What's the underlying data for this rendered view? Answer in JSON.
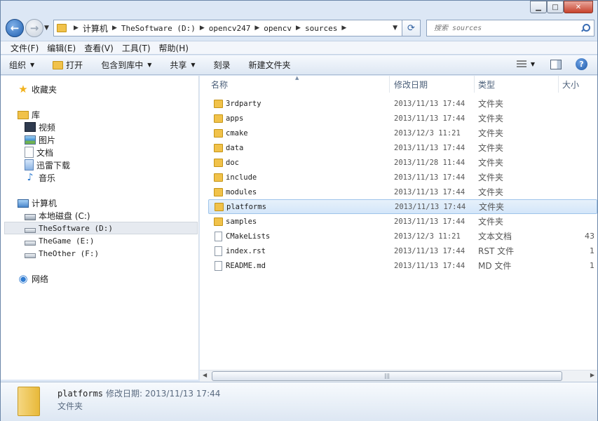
{
  "address": {
    "crumbs": [
      "计算机",
      "TheSoftware (D:)",
      "opencv247",
      "opencv",
      "sources"
    ]
  },
  "search": {
    "placeholder": "搜索 sources"
  },
  "menu": [
    "文件(F)",
    "编辑(E)",
    "查看(V)",
    "工具(T)",
    "帮助(H)"
  ],
  "commands": {
    "organize": "组织",
    "open": "打开",
    "include_library": "包含到库中",
    "share": "共享",
    "burn": "刻录",
    "new_folder": "新建文件夹"
  },
  "nav": {
    "favorites": "收藏夹",
    "libraries": "库",
    "lib_items": [
      "视频",
      "图片",
      "文档",
      "迅雷下载",
      "音乐"
    ],
    "computer": "计算机",
    "drives": [
      "本地磁盘 (C:)",
      "TheSoftware (D:)",
      "TheGame (E:)",
      "TheOther (F:)"
    ],
    "network": "网络"
  },
  "columns": {
    "name": "名称",
    "date": "修改日期",
    "type": "类型",
    "size": "大小"
  },
  "files": [
    {
      "name": "3rdparty",
      "date": "2013/11/13 17:44",
      "type": "文件夹",
      "size": "",
      "kind": "folder"
    },
    {
      "name": "apps",
      "date": "2013/11/13 17:44",
      "type": "文件夹",
      "size": "",
      "kind": "folder"
    },
    {
      "name": "cmake",
      "date": "2013/12/3 11:21",
      "type": "文件夹",
      "size": "",
      "kind": "folder"
    },
    {
      "name": "data",
      "date": "2013/11/13 17:44",
      "type": "文件夹",
      "size": "",
      "kind": "folder"
    },
    {
      "name": "doc",
      "date": "2013/11/28 11:44",
      "type": "文件夹",
      "size": "",
      "kind": "folder"
    },
    {
      "name": "include",
      "date": "2013/11/13 17:44",
      "type": "文件夹",
      "size": "",
      "kind": "folder"
    },
    {
      "name": "modules",
      "date": "2013/11/13 17:44",
      "type": "文件夹",
      "size": "",
      "kind": "folder"
    },
    {
      "name": "platforms",
      "date": "2013/11/13 17:44",
      "type": "文件夹",
      "size": "",
      "kind": "folder"
    },
    {
      "name": "samples",
      "date": "2013/11/13 17:44",
      "type": "文件夹",
      "size": "",
      "kind": "folder"
    },
    {
      "name": "CMakeLists",
      "date": "2013/12/3 11:21",
      "type": "文本文档",
      "size": "43",
      "kind": "file"
    },
    {
      "name": "index.rst",
      "date": "2013/11/13 17:44",
      "type": "RST 文件",
      "size": "1",
      "kind": "file"
    },
    {
      "name": "README.md",
      "date": "2013/11/13 17:44",
      "type": "MD 文件",
      "size": "1",
      "kind": "file"
    }
  ],
  "selected_index": 7,
  "details": {
    "name": "platforms",
    "modified_label": "修改日期: 2013/11/13 17:44",
    "type": "文件夹"
  }
}
